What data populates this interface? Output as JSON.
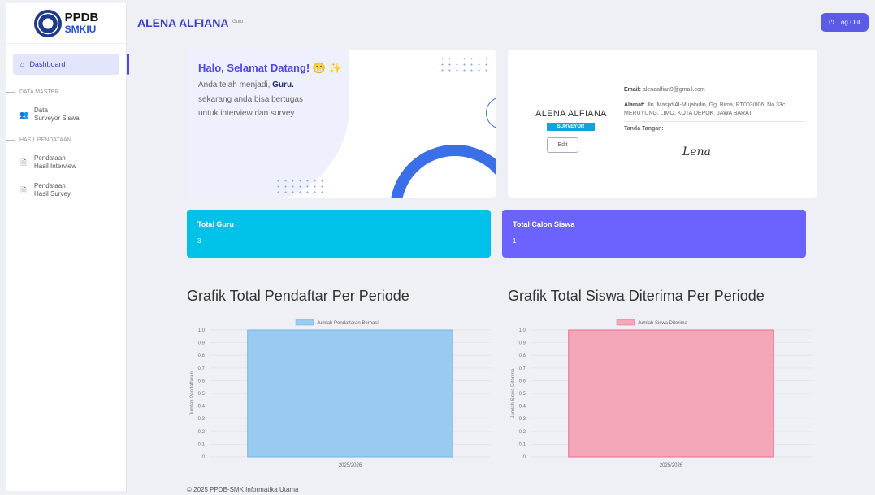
{
  "logo": {
    "line1": "PPDB",
    "line2": "SMKIU"
  },
  "sidebar": {
    "active": {
      "label": "Dashboard",
      "icon": "home-icon"
    },
    "sections": [
      {
        "title": "DATA MASTER",
        "items": [
          {
            "line1": "Data",
            "line2": "Surveyor Siswa",
            "icon": "users-icon"
          }
        ]
      },
      {
        "title": "HASIL PENDATAAN",
        "items": [
          {
            "line1": "Pendataan",
            "line2": "Hasil Interview",
            "icon": "document-icon"
          },
          {
            "line1": "Pendataan",
            "line2": "Hasil Survey",
            "icon": "document-icon"
          }
        ]
      }
    ]
  },
  "header": {
    "name": "ALENA ALFIANA",
    "role": "Guru",
    "logout_label": "Log Out"
  },
  "welcome": {
    "title": "Halo, Selamat Datang! 😁 ✨",
    "line1_prefix": "Anda telah menjadi, ",
    "line1_bold": "Guru.",
    "line2": "sekarang anda bisa bertugas",
    "line3": "untuk interview dan survey"
  },
  "profile": {
    "name": "ALENA ALFIANA",
    "badge": "SURVEYOR",
    "edit_label": "Edit",
    "email_label": "Email:",
    "email": "alenaalfian9@gmail.com",
    "address_label": "Alamat:",
    "address": "Jln. Masjid Al-Mujahidin, Gg. Bima, RT003/006, No.33c, MERUYUNG, LIMO, KOTA DEPOK, JAWA BARAT",
    "signature_label": "Tanda Tangan:",
    "signature": "Lena"
  },
  "stats": [
    {
      "title": "Total Guru",
      "value": "3",
      "color": "#00c2e8"
    },
    {
      "title": "Total Calon Siswa",
      "value": "1",
      "color": "#6c63ff"
    }
  ],
  "chart_data": [
    {
      "type": "bar",
      "title": "Grafik Total Pendaftar Per Periode",
      "categories": [
        "2025/2026"
      ],
      "series": [
        {
          "name": "Jumlah Pendaftaran Berhasil",
          "values": [
            1
          ]
        }
      ],
      "ylabel": "Jumlah Pendaftaran",
      "ylim": [
        0,
        1
      ],
      "yticks": [
        "0",
        "0,1",
        "0,2",
        "0,3",
        "0,4",
        "0,5",
        "0,6",
        "0,7",
        "0,8",
        "0,9",
        "1,0"
      ],
      "fill": "#99caf0",
      "stroke": "#73b3ea",
      "grid": true,
      "legend": "top"
    },
    {
      "type": "bar",
      "title": "Grafik Total Siswa Diterima Per Periode",
      "categories": [
        "2025/2026"
      ],
      "series": [
        {
          "name": "Jumlah Siswa Diterima",
          "values": [
            1
          ]
        }
      ],
      "ylabel": "Jumlah Siswa Diterima",
      "ylim": [
        0,
        1
      ],
      "yticks": [
        "0",
        "0,1",
        "0,2",
        "0,3",
        "0,4",
        "0,5",
        "0,6",
        "0,7",
        "0,8",
        "0,9",
        "1,0"
      ],
      "fill": "#f4a7b9",
      "stroke": "#ec6d8c",
      "grid": true,
      "legend": "top"
    }
  ],
  "footer": "© 2025 PPDB-SMK Informatika Utama"
}
